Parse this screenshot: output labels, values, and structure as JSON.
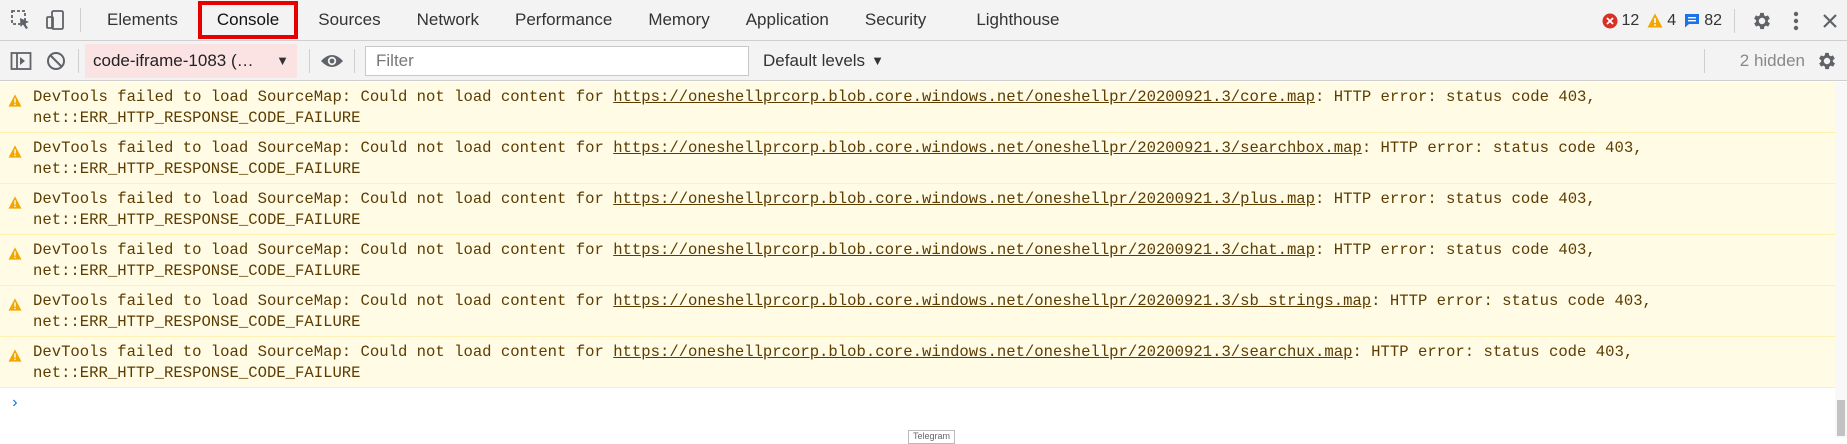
{
  "tabs": [
    "Elements",
    "Console",
    "Sources",
    "Network",
    "Performance",
    "Memory",
    "Application",
    "Security",
    "Lighthouse"
  ],
  "selected_tab": "Console",
  "counts": {
    "errors": "12",
    "warnings": "4",
    "info": "82"
  },
  "toolbar": {
    "context": "code-iframe-1083 (…",
    "filter_placeholder": "Filter",
    "levels": "Default levels",
    "hidden": "2 hidden"
  },
  "messages": [
    {
      "prefix": "DevTools failed to load SourceMap: Could not load content for ",
      "url": "https://oneshellprcorp.blob.core.windows.net/oneshellpr/20200921.3/core.map",
      "suffix": ": HTTP error: status code 403,",
      "line2": "net::ERR_HTTP_RESPONSE_CODE_FAILURE"
    },
    {
      "prefix": "DevTools failed to load SourceMap: Could not load content for ",
      "url": "https://oneshellprcorp.blob.core.windows.net/oneshellpr/20200921.3/searchbox.map",
      "suffix": ": HTTP error: status code 403,",
      "line2": "net::ERR_HTTP_RESPONSE_CODE_FAILURE"
    },
    {
      "prefix": "DevTools failed to load SourceMap: Could not load content for ",
      "url": "https://oneshellprcorp.blob.core.windows.net/oneshellpr/20200921.3/plus.map",
      "suffix": ": HTTP error: status code 403,",
      "line2": "net::ERR_HTTP_RESPONSE_CODE_FAILURE"
    },
    {
      "prefix": "DevTools failed to load SourceMap: Could not load content for ",
      "url": "https://oneshellprcorp.blob.core.windows.net/oneshellpr/20200921.3/chat.map",
      "suffix": ": HTTP error: status code 403,",
      "line2": "net::ERR_HTTP_RESPONSE_CODE_FAILURE"
    },
    {
      "prefix": "DevTools failed to load SourceMap: Could not load content for ",
      "url": "https://oneshellprcorp.blob.core.windows.net/oneshellpr/20200921.3/sb_strings.map",
      "suffix": ": HTTP error: status code 403,",
      "line2": "net::ERR_HTTP_RESPONSE_CODE_FAILURE"
    },
    {
      "prefix": "DevTools failed to load SourceMap: Could not load content for ",
      "url": "https://oneshellprcorp.blob.core.windows.net/oneshellpr/20200921.3/searchux.map",
      "suffix": ": HTTP error: status code 403,",
      "line2": "net::ERR_HTTP_RESPONSE_CODE_FAILURE"
    }
  ],
  "prompt_symbol": "›",
  "telegram_label": "Telegram",
  "icons": {
    "inspect": "inspect-element-icon",
    "device": "device-toolbar-icon",
    "error": "error-icon",
    "warning": "warning-icon",
    "info": "info-icon",
    "settings": "gear-icon",
    "menu": "kebab-menu-icon",
    "close": "close-icon",
    "sidebar": "sidebar-toggle-icon",
    "clear": "clear-console-icon",
    "eye": "eye-icon"
  },
  "colors": {
    "selected_outline": "#e60000",
    "warning_bg": "#fffbe5",
    "warning_text": "#5c3c00",
    "context_bg": "#fbe3e4",
    "error": "#d93025",
    "warning": "#f2a600",
    "info": "#1a73e8"
  }
}
